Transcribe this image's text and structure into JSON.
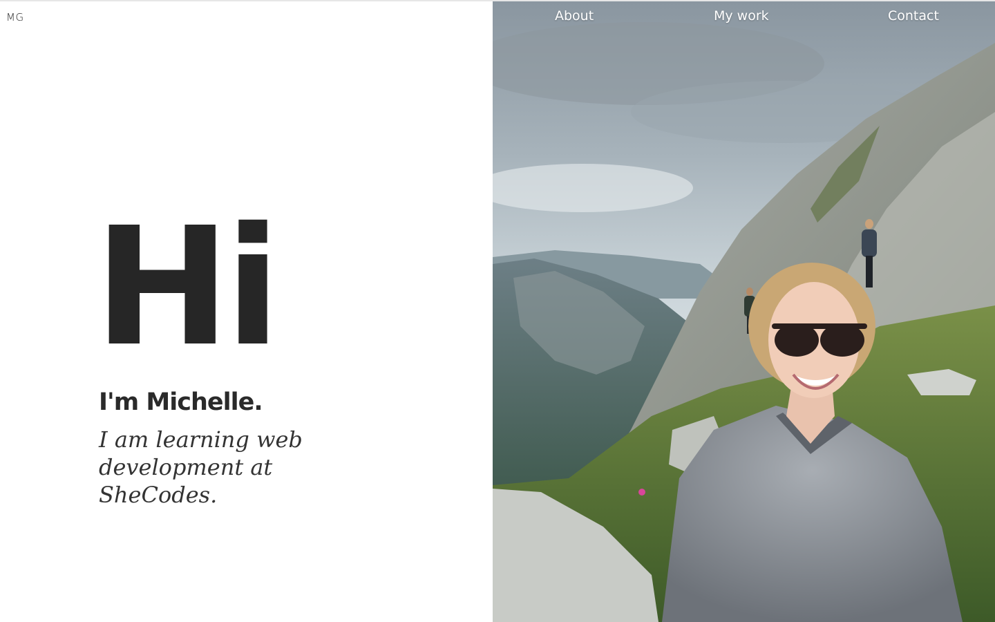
{
  "site": {
    "logo": "MG"
  },
  "nav": {
    "items": [
      {
        "label": "About"
      },
      {
        "label": "My work"
      },
      {
        "label": "Contact"
      }
    ]
  },
  "hero": {
    "greeting": "Hi",
    "name": "I'm Michelle.",
    "tagline": "I am learning web development at SheCodes."
  },
  "photo": {
    "icon": "portrait-photo-mountain"
  },
  "colors": {
    "text": "#262626",
    "nav_text": "#ffffff",
    "background": "#ffffff"
  }
}
